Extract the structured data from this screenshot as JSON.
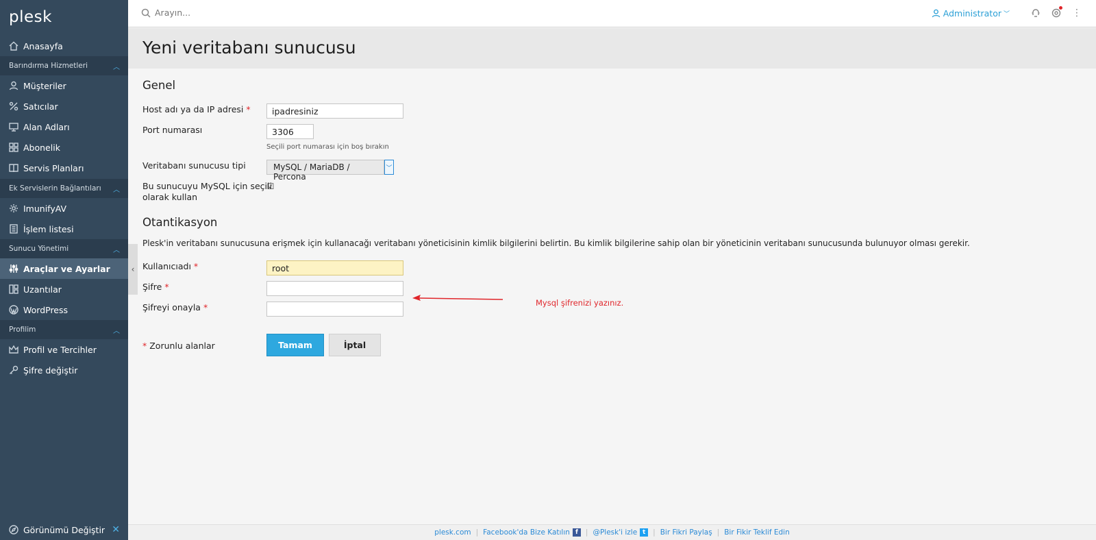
{
  "app": {
    "logo": "plesk"
  },
  "search": {
    "placeholder": "Arayın..."
  },
  "topbar": {
    "user": "Administrator"
  },
  "sidebar": {
    "home": "Anasayfa",
    "sections": [
      {
        "title": "Barındırma Hizmetleri",
        "items": [
          "Müşteriler",
          "Satıcılar",
          "Alan Adları",
          "Abonelik",
          "Servis Planları"
        ]
      },
      {
        "title": "Ek Servislerin Bağlantıları",
        "items": [
          "ImunifyAV",
          "İşlem listesi"
        ]
      },
      {
        "title": "Sunucu Yönetimi",
        "items": [
          "Araçlar ve Ayarlar",
          "Uzantılar",
          "WordPress"
        ]
      },
      {
        "title": "Profilim",
        "items": [
          "Profil ve Tercihler",
          "Şifre değiştir"
        ]
      }
    ],
    "footer": "Görünümü Değiştir"
  },
  "page": {
    "title": "Yeni veritabanı sunucusu"
  },
  "general": {
    "title": "Genel",
    "host_label": "Host adı ya da IP adresi",
    "host_value": "ipadresiniz",
    "port_label": "Port numarası",
    "port_value": "3306",
    "port_hint": "Seçili port numarası için boş bırakın",
    "type_label": "Veritabanı sunucusu tipi",
    "type_value": "MySQL / MariaDB / Percona",
    "default_label_1": "Bu sunucuyu MySQL için seçili",
    "default_label_2": "olarak kullan"
  },
  "auth": {
    "title": "Otantikasyon",
    "description": "Plesk'in veritabanı sunucusuna erişmek için kullanacağı veritabanı yöneticisinin kimlik bilgilerini belirtin. Bu kimlik bilgilerine sahip olan bir yöneticinin veritabanı sunucusunda bulunuyor olması gerekir.",
    "user_label": "Kullanıcıadı",
    "user_value": "root",
    "pass_label": "Şifre",
    "confirm_label": "Şifreyi onayla",
    "annotation": "Mysql şifrenizi yazınız."
  },
  "form": {
    "required_note": "Zorunlu alanlar",
    "ok": "Tamam",
    "cancel": "İptal"
  },
  "footer": {
    "links": [
      "plesk.com",
      "Facebook'da Bize Katılın",
      "@Plesk'i izle",
      "Bir Fikri Paylaş",
      "Bir Fikir Teklif Edin"
    ]
  }
}
